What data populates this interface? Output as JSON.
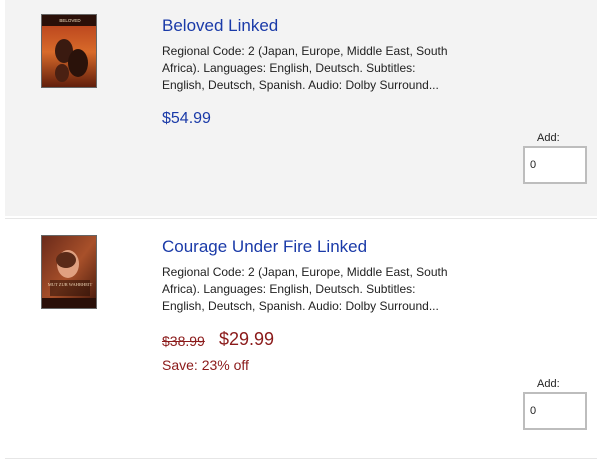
{
  "products": [
    {
      "title": "Beloved Linked",
      "description": "Regional Code: 2 (Japan, Europe, Middle East, South Africa). Languages: English, Deutsch. Subtitles: English, Deutsch, Spanish. Audio: Dolby Surround...",
      "price": "$54.99",
      "cover_text": "BELOVED",
      "add_label": "Add:",
      "quantity_value": "0"
    },
    {
      "title": "Courage Under Fire Linked",
      "description": "Regional Code: 2 (Japan, Europe, Middle East, South Africa). Languages: English, Deutsch. Subtitles: English, Deutsch, Spanish. Audio: Dolby Surround...",
      "original_price": "$38.99",
      "sale_price": "$29.99",
      "savings": "Save: 23% off",
      "cover_text": "MUT ZUR WAHRHEIT",
      "add_label": "Add:",
      "quantity_value": "0"
    }
  ],
  "colors": {
    "link": "#1a3aa8",
    "sale": "#8b1a1a",
    "row_bg_alt": "#f3f3f3"
  }
}
